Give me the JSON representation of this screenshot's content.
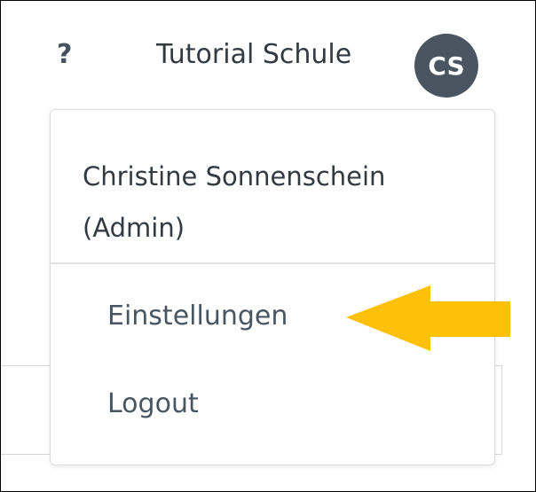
{
  "header": {
    "help_icon_glyph": "?",
    "school_name": "Tutorial Schule",
    "avatar_initials": "CS",
    "avatar_color": "#4a5561"
  },
  "user_menu": {
    "user_name": "Christine Sonnenschein (Admin)",
    "items": [
      {
        "label": "Einstellungen",
        "icon": ""
      },
      {
        "label": "Logout",
        "icon": ""
      }
    ]
  },
  "annotation": {
    "icon": "arrow-left-icon",
    "color": "#ffc107"
  }
}
